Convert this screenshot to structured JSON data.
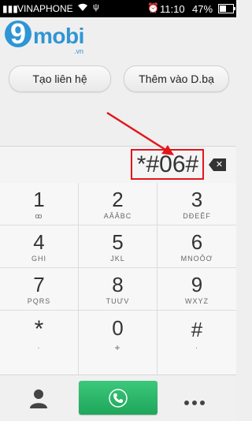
{
  "status_bar": {
    "carrier": "VINAPHONE",
    "time": "11:10",
    "battery": "47%"
  },
  "logo": {
    "mark": "9",
    "name": "mobi",
    "tld": ".vn"
  },
  "actions": {
    "create_contact": "Tạo liên hệ",
    "add_to_contacts": "Thêm vào D.bạ"
  },
  "dialer": {
    "number": "*#06#"
  },
  "keys": [
    {
      "digit": "1",
      "letters": "ꝏ"
    },
    {
      "digit": "2",
      "letters": "AĂÂBC"
    },
    {
      "digit": "3",
      "letters": "DĐEÊF"
    },
    {
      "digit": "4",
      "letters": "GHI"
    },
    {
      "digit": "5",
      "letters": "JKL"
    },
    {
      "digit": "6",
      "letters": "MNOÔƠ"
    },
    {
      "digit": "7",
      "letters": "PQRS"
    },
    {
      "digit": "8",
      "letters": "TUƯV"
    },
    {
      "digit": "9",
      "letters": "WXYZ"
    },
    {
      "digit": "*",
      "letters": "·"
    },
    {
      "digit": "0",
      "letters": "+"
    },
    {
      "digit": "#",
      "letters": "·"
    }
  ],
  "colors": {
    "accent": "#2f95d5",
    "call": "#28b564",
    "highlight": "#e4141b"
  }
}
